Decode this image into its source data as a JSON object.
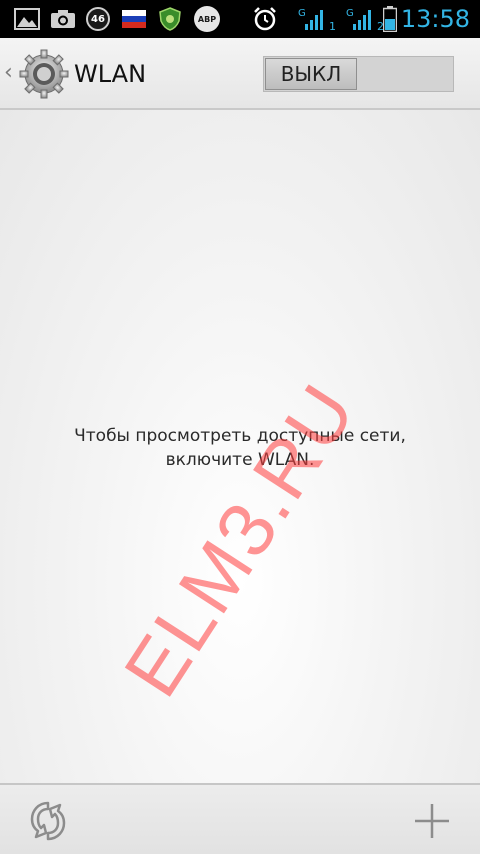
{
  "status_bar": {
    "time": "13:58",
    "time_color": "#33b5e5",
    "badge_text": "46",
    "abp_text": "ABP",
    "sim1_label": "1",
    "sim2_label": "2",
    "icons": [
      "gallery-icon",
      "camera-icon",
      "notification-46-icon",
      "russia-flag-icon",
      "antivirus-icon",
      "adblock-icon",
      "alarm-icon",
      "signal-sim1-icon",
      "signal-sim2-icon",
      "battery-icon"
    ]
  },
  "action_bar": {
    "title": "WLAN",
    "toggle_label": "ВЫКЛ",
    "toggle_state": "off"
  },
  "content": {
    "message_line1": "Чтобы просмотреть доступные сети,",
    "message_line2": "включите WLAN.",
    "watermark": "ELM3.RU",
    "watermark_color": "#ff3c3c"
  },
  "bottom_bar": {
    "icons": [
      "refresh-scan-icon",
      "add-network-icon"
    ]
  }
}
